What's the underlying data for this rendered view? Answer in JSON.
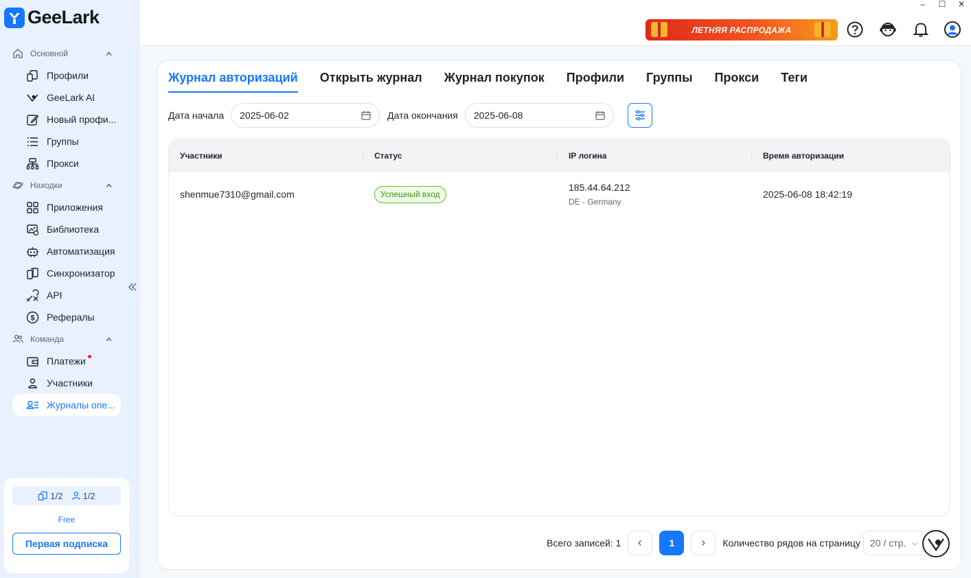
{
  "brand": {
    "name": "GeeLark"
  },
  "sidebar": {
    "sections": [
      {
        "label": "Основной",
        "items": [
          {
            "label": "Профили",
            "icon": "profiles-icon"
          },
          {
            "label": "GeeLark AI",
            "icon": "ai-icon"
          },
          {
            "label": "Новый профи...",
            "icon": "new-profile-icon"
          },
          {
            "label": "Группы",
            "icon": "groups-icon"
          },
          {
            "label": "Прокси",
            "icon": "proxy-icon"
          }
        ]
      },
      {
        "label": "Находки",
        "items": [
          {
            "label": "Приложения",
            "icon": "apps-icon"
          },
          {
            "label": "Библиотека",
            "icon": "library-icon"
          },
          {
            "label": "Автоматизация",
            "icon": "automation-icon"
          },
          {
            "label": "Синхронизатор",
            "icon": "sync-icon"
          },
          {
            "label": "API",
            "icon": "api-icon"
          },
          {
            "label": "Рефералы",
            "icon": "referrals-icon"
          }
        ]
      },
      {
        "label": "Команда",
        "items": [
          {
            "label": "Платежи",
            "icon": "wallet-icon",
            "notification": true
          },
          {
            "label": "Участники",
            "icon": "members-icon"
          },
          {
            "label": "Журналы опе...",
            "icon": "logs-icon",
            "active": true
          }
        ]
      }
    ],
    "plan": {
      "devices": "1/2",
      "members": "1/2",
      "tier": "Free",
      "button": "Первая подписка"
    }
  },
  "topbar": {
    "promo": "ЛЕТНЯЯ РАСПРОДАЖА"
  },
  "tabs": [
    "Журнал авторизаций",
    "Открыть журнал",
    "Журнал покупок",
    "Профили",
    "Группы",
    "Прокси",
    "Теги"
  ],
  "filters": {
    "start_label": "Дата начала",
    "start_value": "2025-06-02",
    "end_label": "Дата окончания",
    "end_value": "2025-06-08"
  },
  "table": {
    "columns": [
      "Участники",
      "Статус",
      "IP логина",
      "Время авторизации"
    ],
    "rows": [
      {
        "member": "shenmue7310@gmail.com",
        "status": "Успешный вход",
        "ip": "185.44.64.212",
        "location": "DE - Germany",
        "time": "2025-06-08 18:42:19"
      }
    ]
  },
  "pagination": {
    "total_label": "Всего записей: 1",
    "current_page": "1",
    "rows_label": "Количество рядов на страницу",
    "page_size": "20 / стр."
  },
  "colors": {
    "accent": "#1677ff",
    "sidebar_bg": "#e8f1fd",
    "success": "#52c41a"
  }
}
